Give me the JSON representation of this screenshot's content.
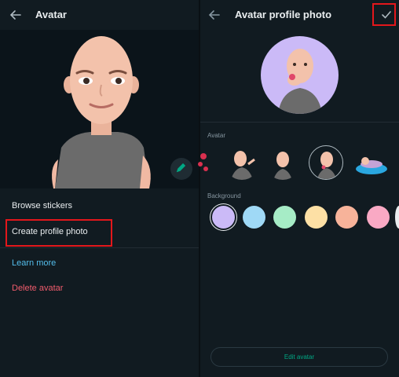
{
  "left_panel": {
    "title": "Avatar",
    "menu": {
      "browse_stickers": "Browse stickers",
      "create_profile_photo": "Create profile photo",
      "learn_more": "Learn more",
      "delete_avatar": "Delete avatar"
    }
  },
  "right_panel": {
    "title": "Avatar profile photo",
    "avatar_label": "Avatar",
    "background_label": "Background",
    "edit_button": "Edit avatar",
    "selected_background": "#cbbaf7",
    "backgrounds": [
      "#cbbaf7",
      "#9fd9f6",
      "#a6ecc6",
      "#fde0a5",
      "#f7b39a",
      "#f9a9c4"
    ]
  },
  "colors": {
    "app_background": "#111b21",
    "accent": "#00a884",
    "link": "#53bdeb",
    "danger": "#f15c6d",
    "highlight": "#e3171b"
  },
  "icons": {
    "back": "arrow-left-icon",
    "edit": "pencil-icon",
    "confirm": "check-icon"
  }
}
